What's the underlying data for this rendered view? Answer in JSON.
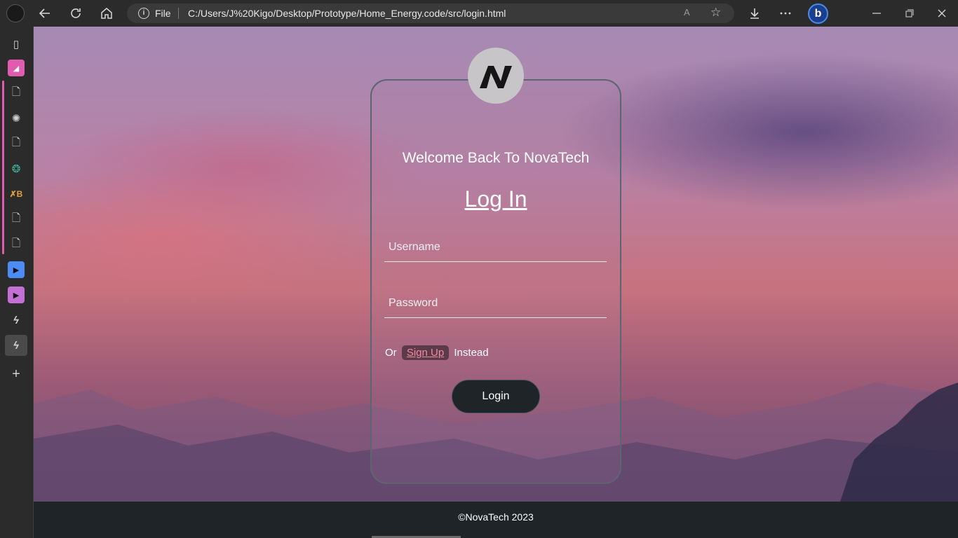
{
  "browser": {
    "file_label": "File",
    "url": "C:/Users/J%20Kigo/Desktop/Prototype/Home_Energy.code/src/login.html",
    "read_aloud": "A",
    "copilot": "b"
  },
  "login": {
    "welcome": "Welcome Back To NovaTech",
    "title": "Log In",
    "username_placeholder": "Username",
    "password_placeholder": "Password",
    "or_text": "Or",
    "signup_link": "Sign Up",
    "instead_text": "Instead",
    "login_button": "Login"
  },
  "footer": {
    "text": "©NovaTech 2023"
  },
  "colors": {
    "card_border": "#5b6671",
    "footer_bg": "#1e2427",
    "signup_bg": "#5d3a4a",
    "signup_text": "#f08aa0",
    "sidebar_accent": "#e05cb1"
  }
}
